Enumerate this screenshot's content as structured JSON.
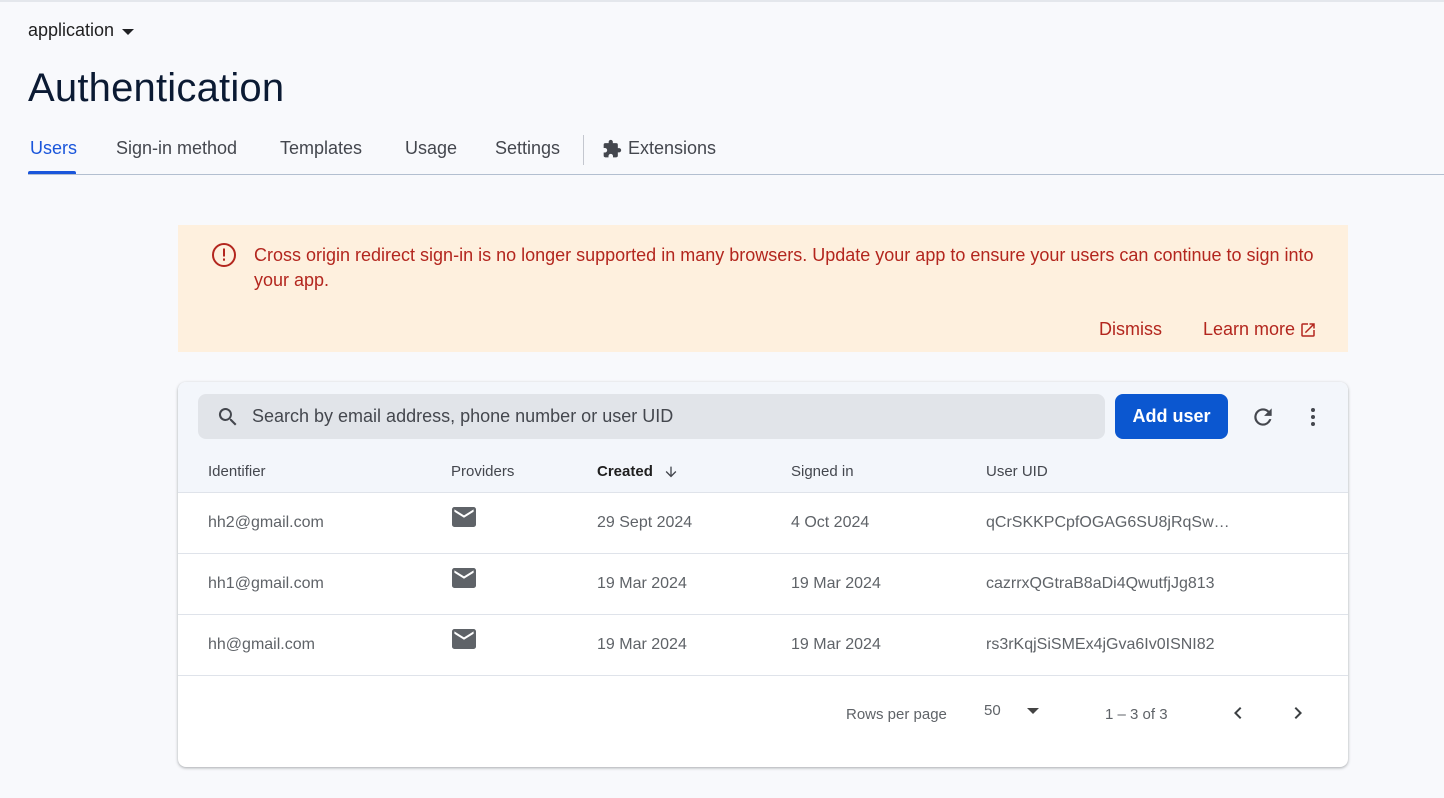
{
  "header": {
    "project_name": "application",
    "page_title": "Authentication"
  },
  "tabs": [
    {
      "label": "Users",
      "active": true
    },
    {
      "label": "Sign-in method"
    },
    {
      "label": "Templates"
    },
    {
      "label": "Usage"
    },
    {
      "label": "Settings"
    },
    {
      "label": "Extensions",
      "icon": "puzzle-icon"
    }
  ],
  "banner": {
    "message": "Cross origin redirect sign-in is no longer supported in many browsers. Update your app to ensure your users can continue to sign into your app.",
    "dismiss_label": "Dismiss",
    "learn_more_label": "Learn more",
    "icon": "error-circle-icon",
    "color": "#b3261e",
    "background": "#fef0de"
  },
  "users_table": {
    "search_placeholder": "Search by email address, phone number or user UID",
    "add_user_label": "Add user",
    "columns": [
      "Identifier",
      "Providers",
      "Created",
      "Signed in",
      "User UID"
    ],
    "sorted_column": "Created",
    "rows": [
      {
        "identifier": "hh2@gmail.com",
        "provider": "email-icon",
        "created": "29 Sept 2024",
        "signed_in": "4 Oct 2024",
        "uid": "qCrSKKPCpfOGAG6SU8jRqSw…"
      },
      {
        "identifier": "hh1@gmail.com",
        "provider": "email-icon",
        "created": "19 Mar 2024",
        "signed_in": "19 Mar 2024",
        "uid": "cazrrxQGtraB8aDi4QwutfjJg813"
      },
      {
        "identifier": "hh@gmail.com",
        "provider": "email-icon",
        "created": "19 Mar 2024",
        "signed_in": "19 Mar 2024",
        "uid": "rs3rKqjSiSMEx4jGva6Iv0ISNI82"
      }
    ],
    "pagination": {
      "rows_per_page_label": "Rows per page",
      "rows_per_page": "50",
      "range_text": "1 – 3 of 3"
    }
  },
  "colors": {
    "accent": "#0b57d0",
    "tab_active": "#1a56db"
  }
}
